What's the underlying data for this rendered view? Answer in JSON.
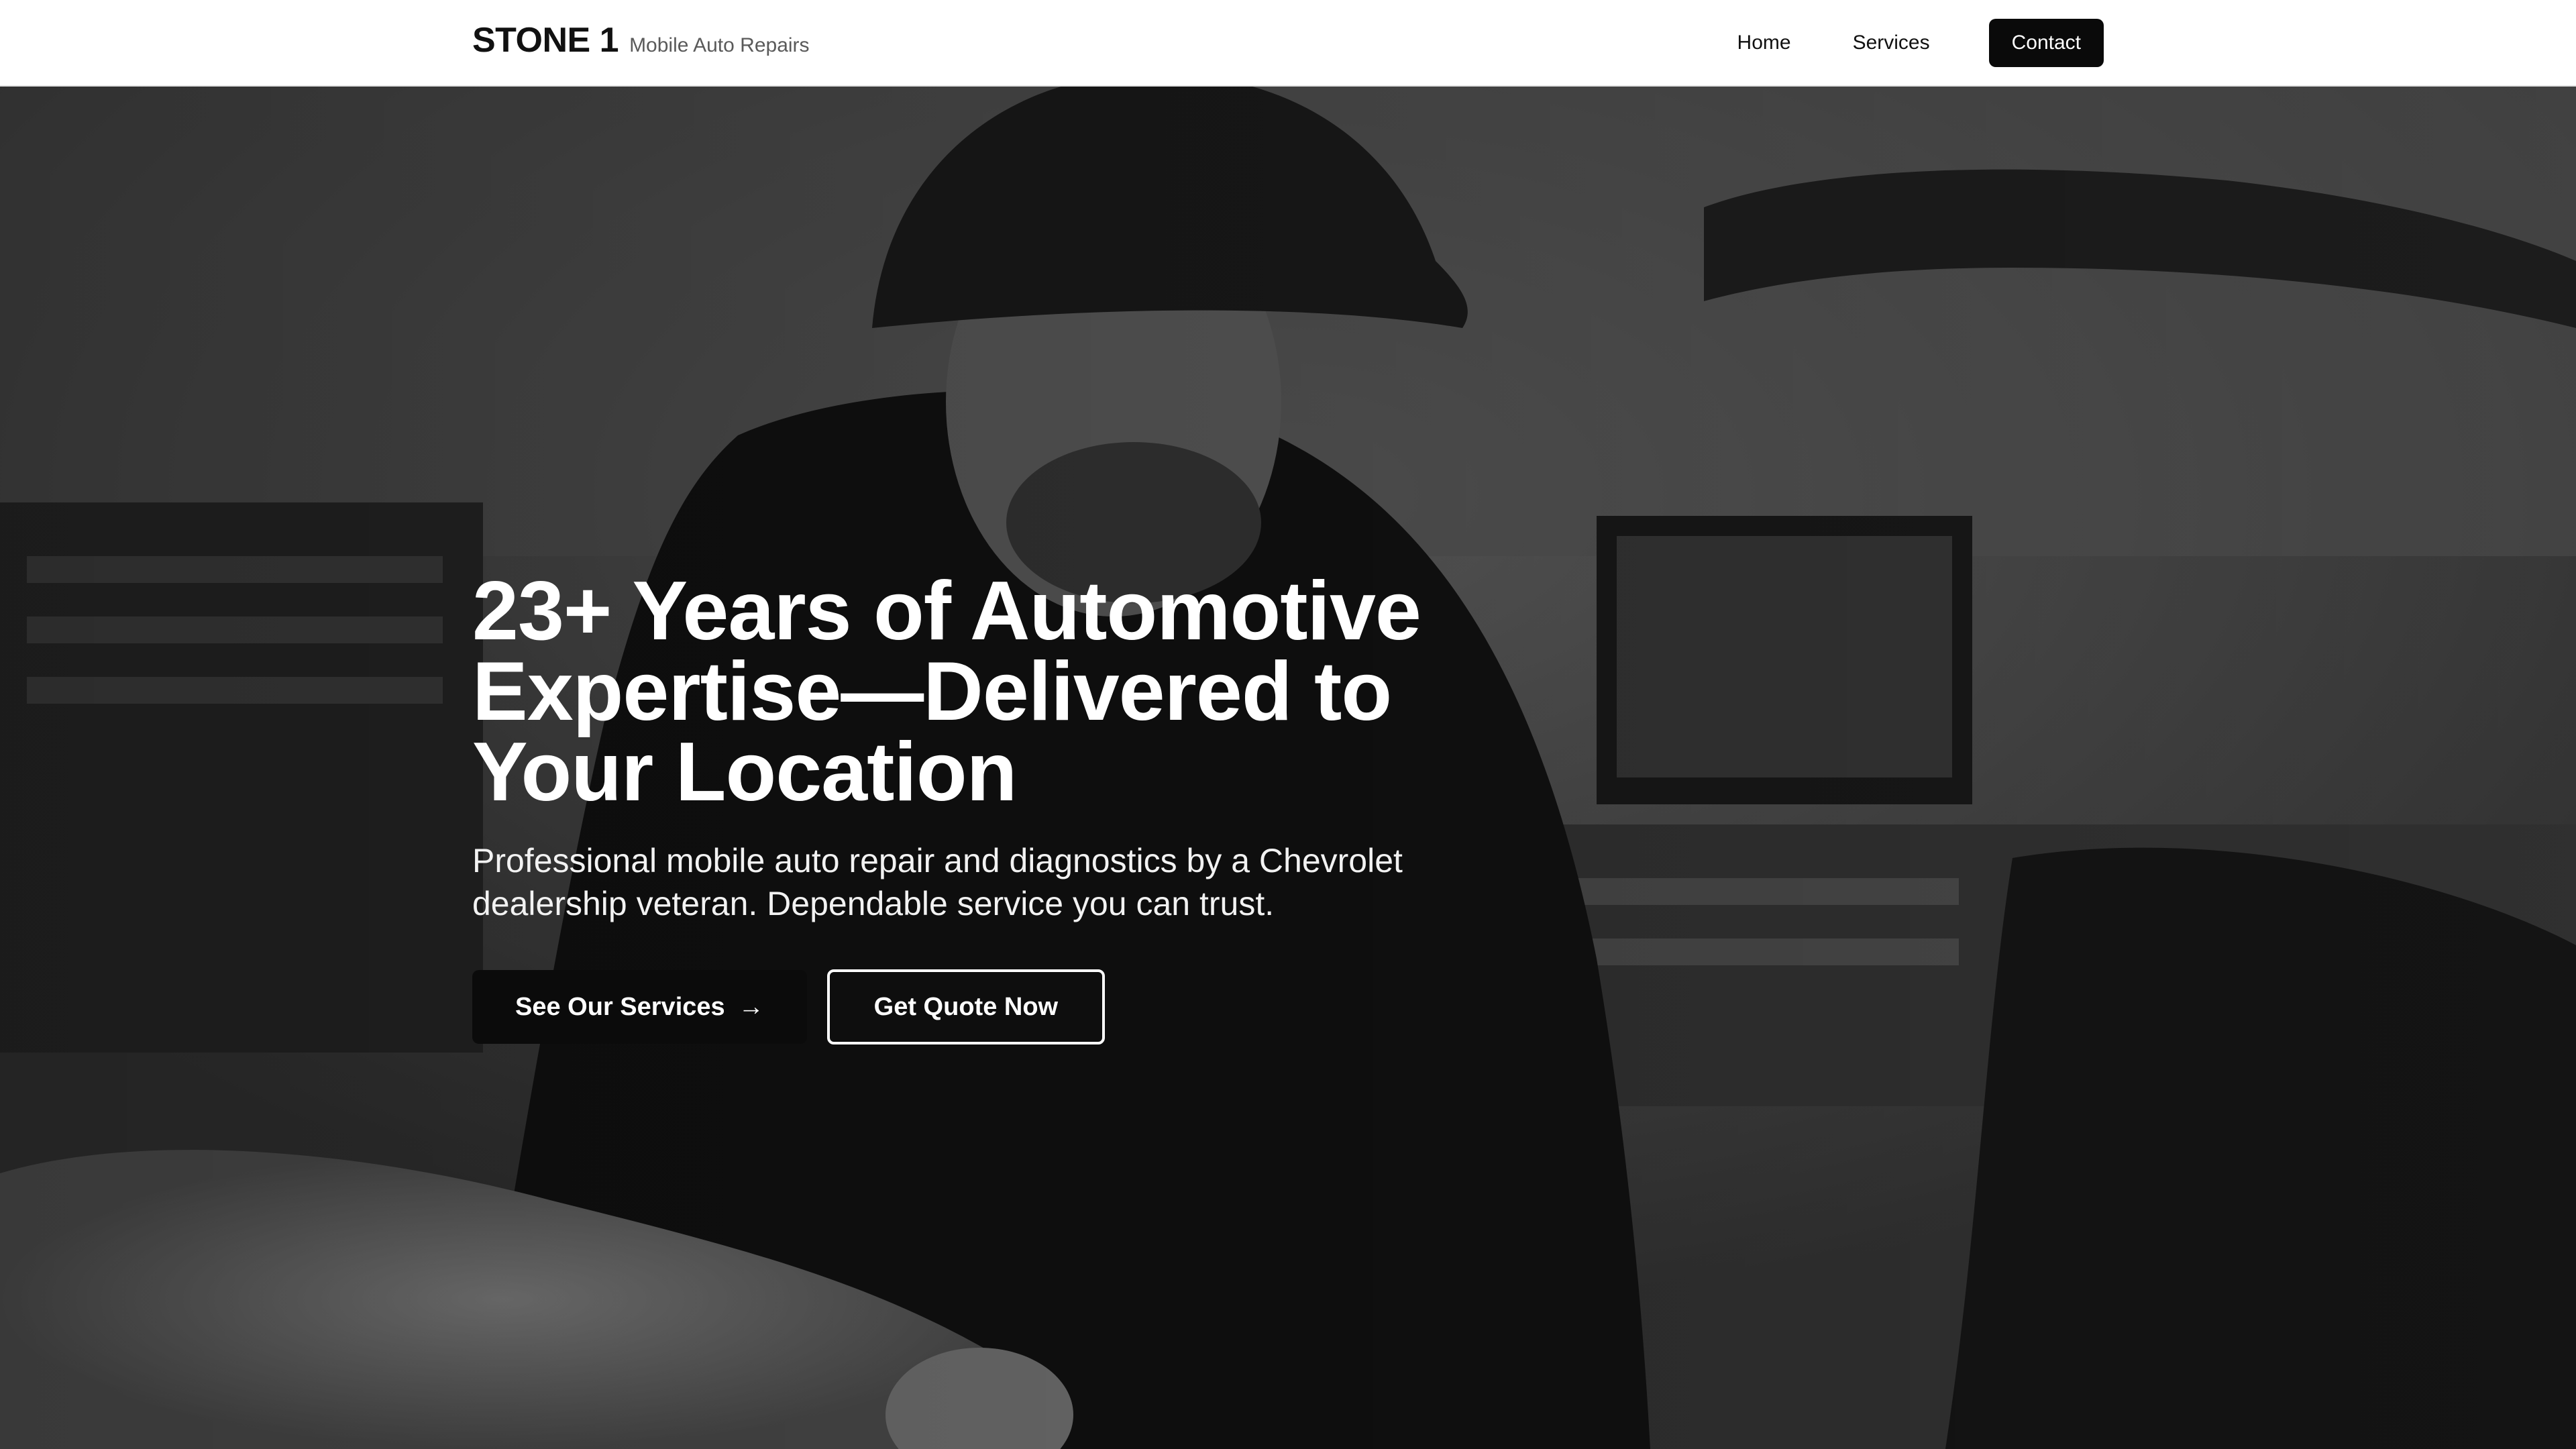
{
  "header": {
    "brand_name": "STONE 1",
    "brand_tagline": "Mobile Auto Repairs",
    "nav": {
      "home": "Home",
      "services": "Services",
      "contact": "Contact"
    }
  },
  "hero": {
    "title": "23+ Years of Automotive Expertise—Delivered to Your Location",
    "subtitle": "Professional mobile auto repair and diagnostics by a Chevrolet dealership veteran. Dependable service you can trust.",
    "primary_button": "See Our Services",
    "primary_button_icon": "arrow-right-icon",
    "secondary_button": "Get Quote Now",
    "background_image": "mechanic-working-grayscale-photo"
  },
  "colors": {
    "header_bg": "#ffffff",
    "text_dark": "#111111",
    "button_dark": "#0b0b0b",
    "hero_text": "#ffffff"
  }
}
